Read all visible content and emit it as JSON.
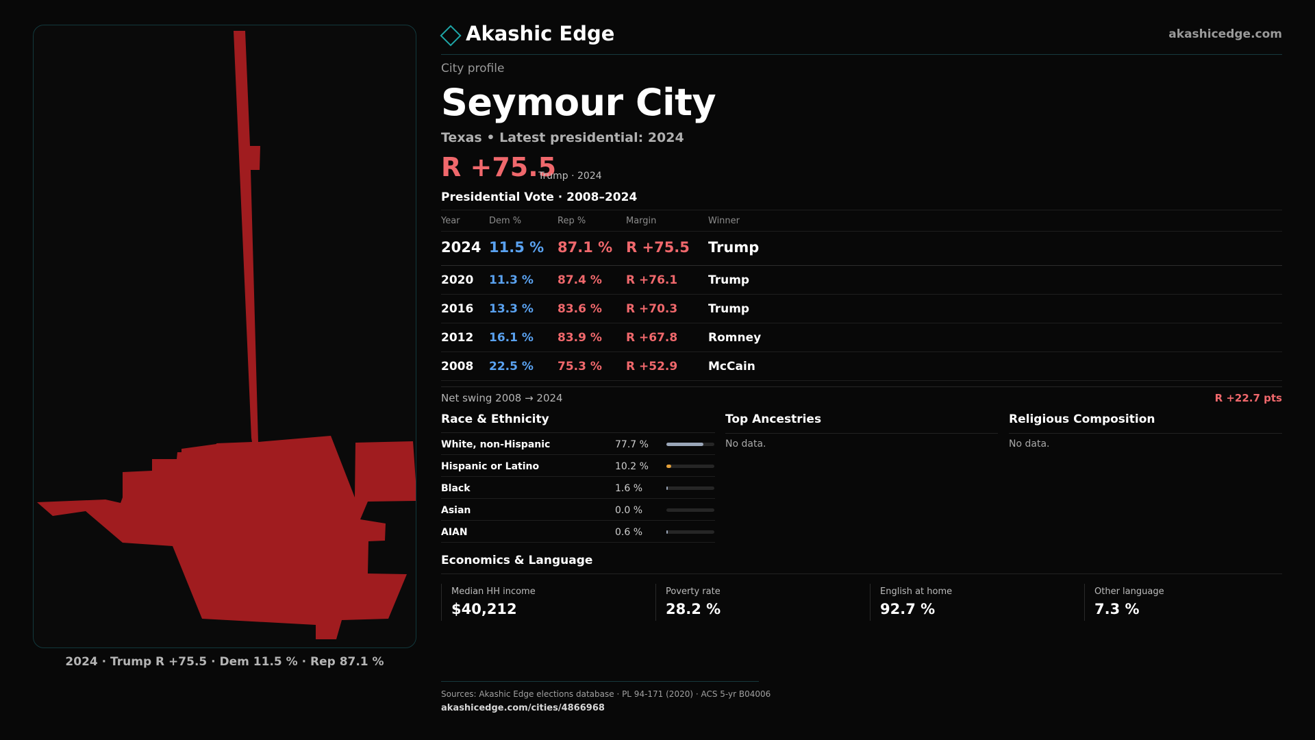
{
  "brand": {
    "name": "Akashic Edge",
    "site": "akashicedge.com"
  },
  "profile": {
    "kicker": "City profile",
    "title": "Seymour City",
    "subtitle": "Texas  • Latest presidential: 2024",
    "margin": "R +75.5",
    "margin_note": "Trump · 2024"
  },
  "map": {
    "caption": "2024 · Trump R +75.5 · Dem 11.5 % · Rep 87.1 %",
    "fill_color": "#a01c1f",
    "frame_color": "#12393d"
  },
  "vote": {
    "heading": "Presidential Vote · 2008–2024",
    "headers": {
      "year": "Year",
      "dem": "Dem %",
      "rep": "Rep %",
      "margin": "Margin",
      "winner": "Winner"
    },
    "rows": [
      {
        "year": "2024",
        "dem": "11.5 %",
        "rep": "87.1 %",
        "margin": "R +75.5",
        "winner": "Trump"
      },
      {
        "year": "2020",
        "dem": "11.3 %",
        "rep": "87.4 %",
        "margin": "R +76.1",
        "winner": "Trump"
      },
      {
        "year": "2016",
        "dem": "13.3 %",
        "rep": "83.6 %",
        "margin": "R +70.3",
        "winner": "Trump"
      },
      {
        "year": "2012",
        "dem": "16.1 %",
        "rep": "83.9 %",
        "margin": "R +67.8",
        "winner": "Romney"
      },
      {
        "year": "2008",
        "dem": "22.5 %",
        "rep": "75.3 %",
        "margin": "R +52.9",
        "winner": "McCain"
      }
    ],
    "swing_label": "Net swing 2008 → 2024",
    "swing_value": "R +22.7 pts"
  },
  "race": {
    "heading": "Race & Ethnicity",
    "rows": [
      {
        "name": "White, non-Hispanic",
        "pct": "77.7 %",
        "share": 0.777,
        "color": "#9aa6b8"
      },
      {
        "name": "Hispanic or Latino",
        "pct": "10.2 %",
        "share": 0.102,
        "color": "#e3a03a"
      },
      {
        "name": "Black",
        "pct": "1.6 %",
        "share": 0.016,
        "color": "#9aa6b8"
      },
      {
        "name": "Asian",
        "pct": "0.0 %",
        "share": 0.0,
        "color": "#9aa6b8"
      },
      {
        "name": "AIAN",
        "pct": "0.6 %",
        "share": 0.006,
        "color": "#9aa6b8"
      }
    ]
  },
  "ancestry": {
    "heading": "Top Ancestries",
    "empty": "No data."
  },
  "religion": {
    "heading": "Religious Composition",
    "empty": "No data."
  },
  "economics": {
    "heading": "Economics & Language",
    "stats": [
      {
        "label": "Median HH income",
        "value": "$40,212"
      },
      {
        "label": "Poverty rate",
        "value": "28.2 %"
      },
      {
        "label": "English at home",
        "value": "92.7 %"
      },
      {
        "label": "Other language",
        "value": "7.3 %"
      }
    ]
  },
  "footer": {
    "sources": "Sources: Akashic Edge elections database · PL 94-171 (2020) · ACS 5-yr B04006",
    "url": "akashicedge.com/cities/4866968"
  }
}
